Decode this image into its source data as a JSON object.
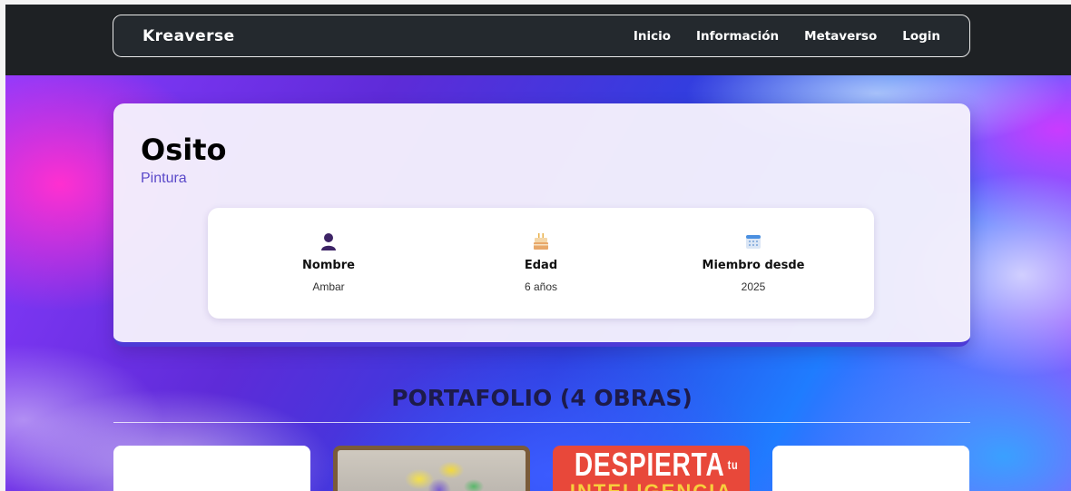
{
  "brand": "Kreaverse",
  "nav": {
    "items": [
      {
        "label": "Inicio"
      },
      {
        "label": "Información"
      },
      {
        "label": "Metaverso"
      },
      {
        "label": "Login"
      }
    ]
  },
  "profile": {
    "name": "Osito",
    "category": "Pintura",
    "info": [
      {
        "icon": "user-icon",
        "label": "Nombre",
        "value": "Ambar"
      },
      {
        "icon": "birthday-cake-icon",
        "label": "Edad",
        "value": "6 años"
      },
      {
        "icon": "calendar-icon",
        "label": "Miembro desde",
        "value": "2025"
      }
    ]
  },
  "portfolio": {
    "title": "PORTAFOLIO (4 OBRAS)",
    "works": [
      {
        "type": "blank"
      },
      {
        "type": "painting"
      },
      {
        "type": "poster",
        "text_line1": "DESPIERTA",
        "text_sup": "tu",
        "text_line2": "INTELIGENCIA"
      },
      {
        "type": "blank"
      }
    ]
  },
  "colors": {
    "nav_bg": "#24292e",
    "accent": "#4d3bd6",
    "category_text": "#5a49c9",
    "poster_red": "#e8483a"
  }
}
